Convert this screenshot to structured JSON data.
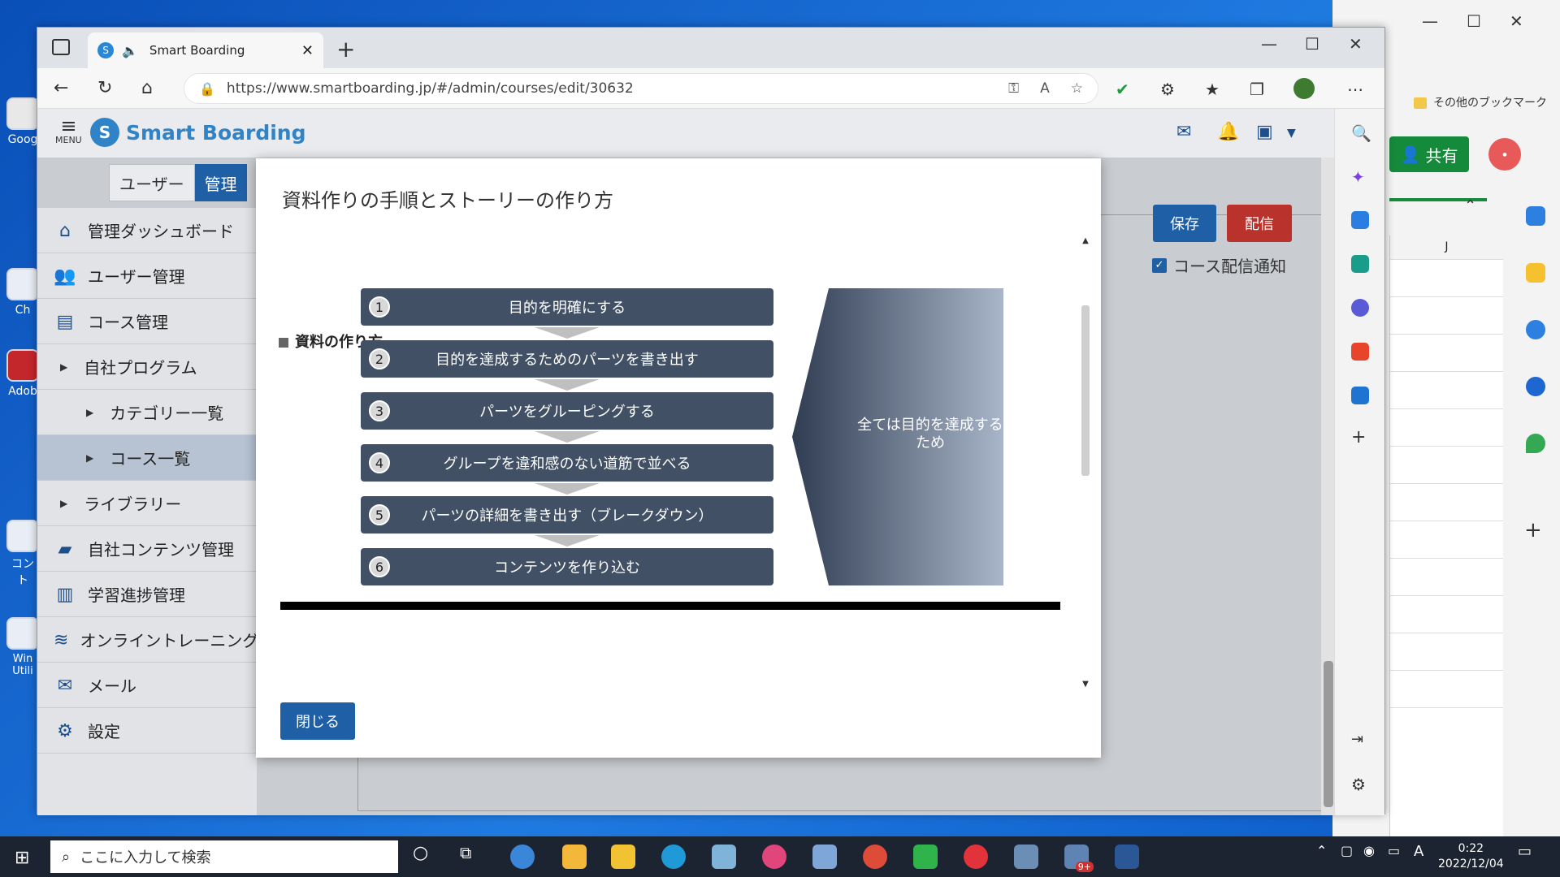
{
  "browser": {
    "tab_title": "Smart Boarding",
    "url": "https://www.smartboarding.jp/#/admin/courses/edit/30632"
  },
  "app": {
    "logo": "Smart Boarding",
    "menu_label": "MENU",
    "segments": {
      "user": "ユーザー",
      "admin": "管理"
    },
    "buttons": {
      "save": "保存",
      "deliver": "配信"
    },
    "notify_label": "コース配信通知",
    "sidebar": [
      {
        "label": "管理ダッシュボード",
        "icon": "home-icon"
      },
      {
        "label": "ユーザー管理",
        "icon": "users-icon"
      },
      {
        "label": "コース管理",
        "icon": "book-icon"
      },
      {
        "label": "自社プログラム",
        "icon": "caret-right-icon"
      },
      {
        "label": "カテゴリー一覧",
        "icon": "caret-right-icon"
      },
      {
        "label": "コース一覧",
        "icon": "caret-right-icon"
      },
      {
        "label": "ライブラリー",
        "icon": "caret-right-icon"
      },
      {
        "label": "自社コンテンツ管理",
        "icon": "folder-icon"
      },
      {
        "label": "学習進捗管理",
        "icon": "chart-icon"
      },
      {
        "label": "オンライントレーニング",
        "icon": "wifi-icon"
      },
      {
        "label": "メール",
        "icon": "mail-icon"
      },
      {
        "label": "設定",
        "icon": "gear-icon"
      }
    ]
  },
  "modal": {
    "title": "資料作りの手順とストーリーの作り方",
    "section": "資料の作り方",
    "steps": [
      {
        "num": "1",
        "text": "目的を明確にする"
      },
      {
        "num": "2",
        "text": "目的を達成するためのパーツを書き出す"
      },
      {
        "num": "3",
        "text": "パーツをグルーピングする"
      },
      {
        "num": "4",
        "text": "グループを違和感のない道筋で並べる"
      },
      {
        "num": "5",
        "text": "パーツの詳細を書き出す（ブレークダウン）"
      },
      {
        "num": "6",
        "text": "コンテンツを作り込む"
      }
    ],
    "goal_text": "全ては目的を達成するため",
    "close": "閉じる"
  },
  "background_window": {
    "bookmark": "その他のブックマーク",
    "share": "共有",
    "column": "J"
  },
  "taskbar": {
    "search_placeholder": "ここに入力して検索",
    "time": "0:22",
    "date": "2022/12/04",
    "ime": "A",
    "badge": "9+"
  },
  "desktop_icons": [
    "Goog",
    "Ch",
    "Adob",
    "コント",
    "Win Utili"
  ],
  "colors": {
    "primary": "#1f5fa5",
    "danger": "#b9322c",
    "step": "#425066"
  }
}
